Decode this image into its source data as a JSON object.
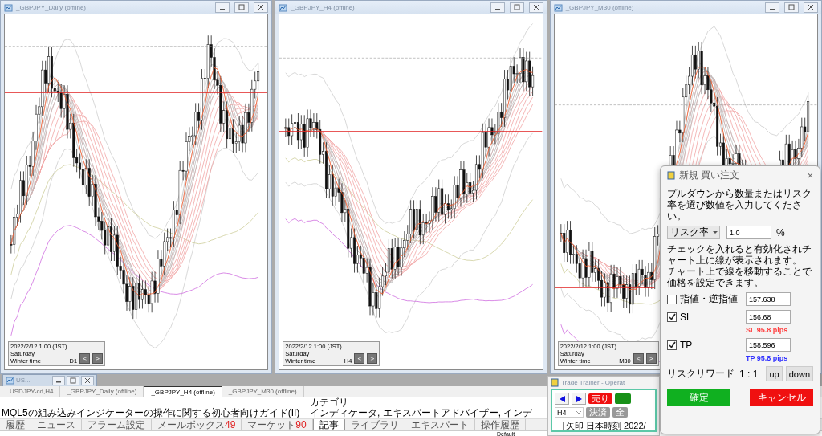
{
  "chart_windows": [
    {
      "title": "_GBPJPY_Daily (offline)",
      "info": {
        "date": "2022/2/12 1:00 (JST)",
        "day": "Saturday",
        "season": "Winter time",
        "timeframe": "D1"
      },
      "prev": "<",
      "next": ">"
    },
    {
      "title": "_GBPJPY_H4 (offline)",
      "info": {
        "date": "2022/2/12 1:00 (JST)",
        "day": "Saturday",
        "season": "Winter time",
        "timeframe": "H4"
      },
      "prev": "<",
      "next": ">"
    },
    {
      "title": "_GBPJPY_M30 (offline)",
      "info": {
        "date": "2022/2/12 1:00 (JST)",
        "day": "Saturday",
        "season": "Winter time",
        "timeframe": "M30"
      },
      "prev": "<",
      "next": ">"
    }
  ],
  "minimized_window": {
    "title": "US..."
  },
  "chart_tabs": [
    {
      "label": "USDJPY-cd,H4",
      "selected": false
    },
    {
      "label": "_GBPJPY_Daily (offline)",
      "selected": false
    },
    {
      "label": "_GBPJPY_H4 (offline)",
      "selected": true
    },
    {
      "label": "_GBPJPY_M30 (offline)",
      "selected": false
    }
  ],
  "article": {
    "title": "MQL5の組み込みインジケーターの操作に関する初心者向けガイド(II)",
    "category_header": "カテゴリ",
    "categories": "インディケータ, エキスパートアドバイザー, インデ"
  },
  "terminal_tabs": [
    {
      "label": "履歴",
      "selected": false
    },
    {
      "label": "ニュース",
      "selected": false
    },
    {
      "label": "アラーム設定",
      "selected": false
    },
    {
      "label": "メールボックス",
      "count": "49",
      "selected": false
    },
    {
      "label": "マーケット",
      "count": "90",
      "selected": false
    },
    {
      "label": "記事",
      "selected": true
    },
    {
      "label": "ライブラリ",
      "selected": false
    },
    {
      "label": "エキスパート",
      "selected": false
    },
    {
      "label": "操作履歴",
      "selected": false
    }
  ],
  "grid_header": "Default",
  "trade_trainer": {
    "title": "Trade Trainer - Operat",
    "sell": "売り",
    "timeframe": "H4",
    "close": "決済",
    "close_all": "全",
    "arrow_checkbox": {
      "label": "矢印",
      "checked": false
    },
    "time_label": "日本時刻 2022/"
  },
  "order_dialog": {
    "title": "新規 買い注文",
    "close": "×",
    "instruction": "プルダウンから数量またはリスク率を選び数値を入力してください。",
    "mode": "リスク率",
    "amount": "1.0",
    "unit": "%",
    "notes": [
      "チェックを入れると有効化されチャート上に線が表示されます。",
      "チャート上で線を移動することで価格を設定できます。"
    ],
    "rows": [
      {
        "label": "指値・逆指値",
        "checked": false,
        "value": "157.638"
      },
      {
        "label": "SL",
        "checked": true,
        "value": "156.68",
        "note": "SL 95.8 pips",
        "color": "#ff4040"
      },
      {
        "label": "TP",
        "checked": true,
        "value": "158.596",
        "note": "TP 95.8 pips",
        "color": "#3030ff"
      }
    ],
    "risk_reward_label": "リスクリワード",
    "risk_reward": "1 : 1",
    "up": "up",
    "down": "down",
    "confirm": "確定",
    "cancel": "キャンセル"
  }
}
